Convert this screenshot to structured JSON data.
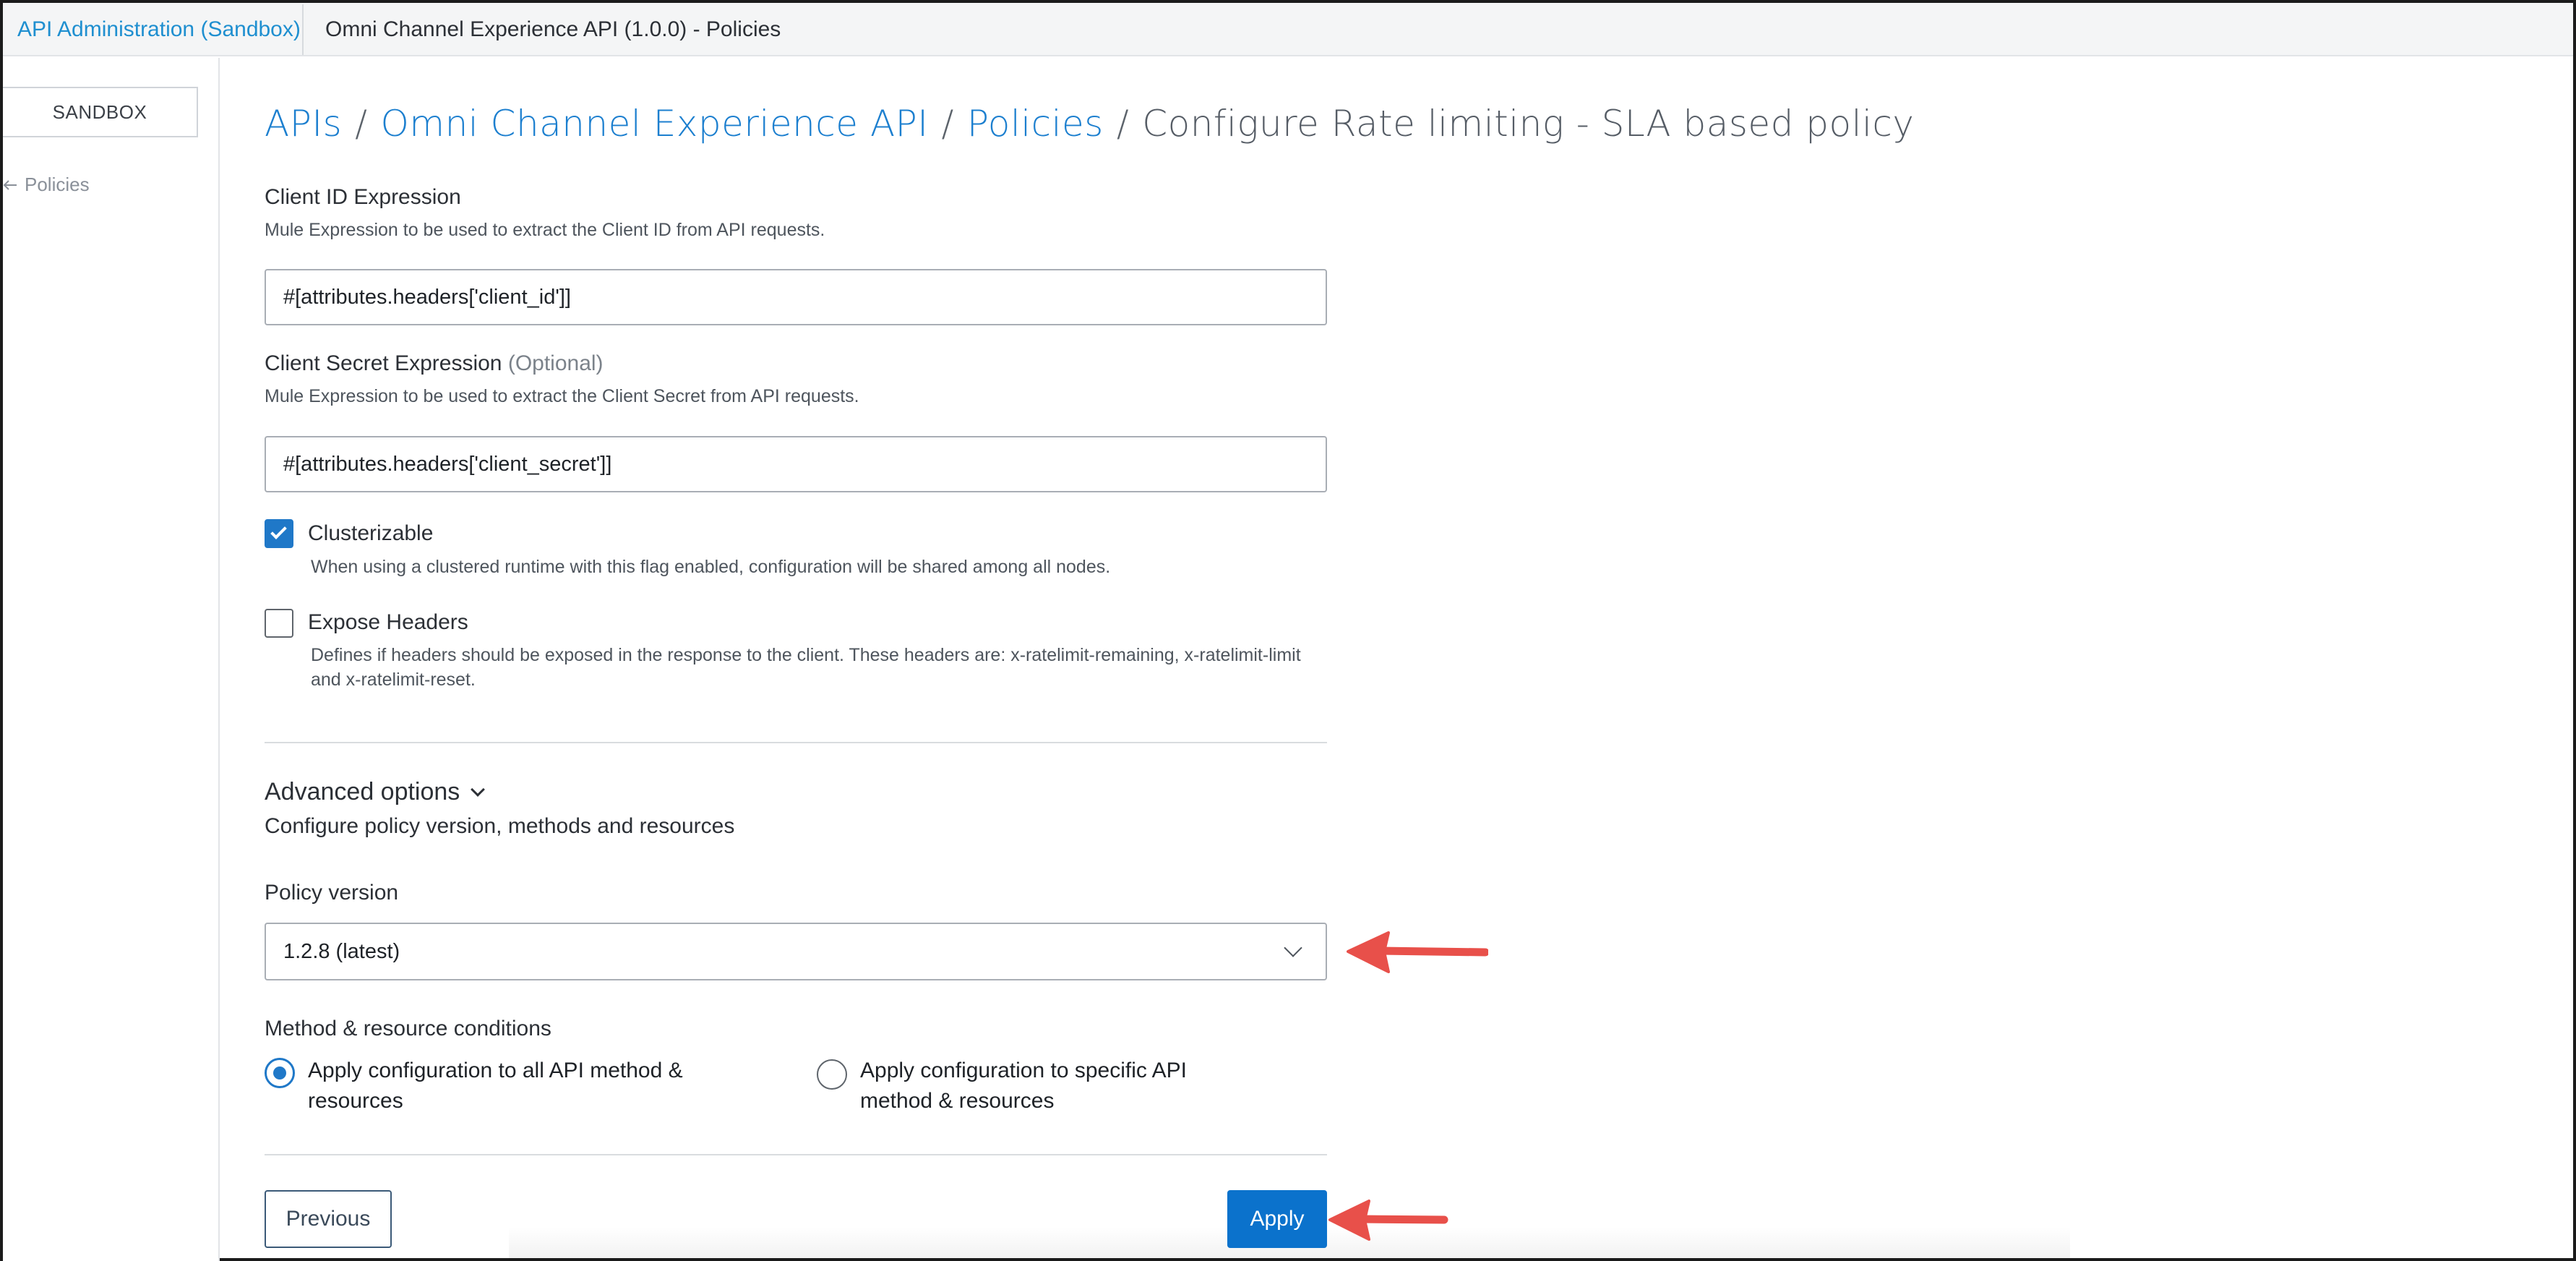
{
  "topbar": {
    "parent_link": "API Administration (Sandbox)",
    "current": "Omni Channel Experience API (1.0.0) - Policies"
  },
  "sidebar": {
    "environment_label": "SANDBOX",
    "back_label": "Policies",
    "back_icon": "arrow-left-icon"
  },
  "breadcrumb": {
    "items": [
      "APIs",
      "Omni Channel Experience API",
      "Policies"
    ],
    "separator": "/",
    "current": "Configure Rate limiting - SLA based policy"
  },
  "form": {
    "client_id": {
      "label": "Client ID Expression",
      "help": "Mule Expression to be used to extract the Client ID from API requests.",
      "value": "#[attributes.headers['client_id']]"
    },
    "client_secret": {
      "label": "Client Secret Expression",
      "optional_tag": "(Optional)",
      "help": "Mule Expression to be used to extract the Client Secret from API requests.",
      "value": "#[attributes.headers['client_secret']]"
    },
    "clusterizable": {
      "label": "Clusterizable",
      "checked": true,
      "help": "When using a clustered runtime with this flag enabled, configuration will be shared among all nodes."
    },
    "expose_headers": {
      "label": "Expose Headers",
      "checked": false,
      "help_line1": "Defines if headers should be exposed in the response to the client. These headers are: x-ratelimit-remaining, x-ratelimit-limit",
      "help_line2": "and x-ratelimit-reset."
    }
  },
  "advanced": {
    "title": "Advanced options",
    "subtitle": "Configure policy version, methods and resources",
    "policy_version": {
      "label": "Policy version",
      "selected": "1.2.8 (latest)"
    },
    "conditions": {
      "label": "Method & resource conditions",
      "option_all": "Apply configuration to all API method & resources",
      "option_specific": "Apply configuration to specific API method & resources",
      "selected": "all"
    }
  },
  "actions": {
    "previous": "Previous",
    "apply": "Apply"
  },
  "colors": {
    "accent": "#1f78c8",
    "link": "#1c7fcf",
    "annotation_arrow": "#e8504a"
  }
}
